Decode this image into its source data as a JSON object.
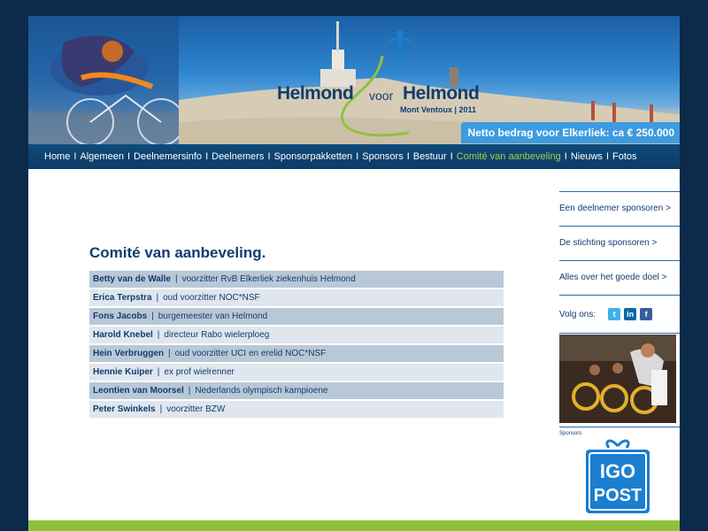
{
  "header": {
    "logo": {
      "word1": "Helmond",
      "word2": "voor",
      "word3": "Helmond",
      "subtitle": "Mont Ventoux | 2011"
    },
    "netto": "Netto bedrag voor Elkerliek: ca € 250.000"
  },
  "nav": {
    "items": [
      {
        "label": "Home",
        "active": false
      },
      {
        "label": "Algemeen",
        "active": false
      },
      {
        "label": "Deelnemersinfo",
        "active": false
      },
      {
        "label": "Deelnemers",
        "active": false
      },
      {
        "label": "Sponsorpakketten",
        "active": false
      },
      {
        "label": "Sponsors",
        "active": false
      },
      {
        "label": "Bestuur",
        "active": false
      },
      {
        "label": "Comité van aanbeveling",
        "active": true
      },
      {
        "label": "Nieuws",
        "active": false
      },
      {
        "label": "Fotos",
        "active": false
      }
    ],
    "separator": "I"
  },
  "main": {
    "title": "Comité van aanbeveling.",
    "members": [
      {
        "name": "Betty van de Walle",
        "role": "voorzitter RvB Elkerliek ziekenhuis Helmond"
      },
      {
        "name": "Erica Terpstra",
        "role": "oud voorzitter NOC*NSF"
      },
      {
        "name": "Fons Jacobs",
        "role": "burgemeester van Helmond"
      },
      {
        "name": "Harold Knebel",
        "role": "directeur Rabo wielerploeg"
      },
      {
        "name": "Hein Verbruggen",
        "role": "oud voorzitter UCI en erelid NOC*NSF"
      },
      {
        "name": "Hennie Kuiper",
        "role": "ex prof wielrenner"
      },
      {
        "name": "Leontien van Moorsel",
        "role": "Nederlands olympisch kampioene"
      },
      {
        "name": "Peter Swinkels",
        "role": "voorzitter BZW"
      }
    ],
    "divider": "|"
  },
  "sidebar": {
    "links": [
      "Een deelnemer sponsoren >",
      "De stichting sponsoren >",
      "Alles over het goede doel >"
    ],
    "follow_label": "Volg ons:",
    "social": [
      "twitter-icon",
      "linkedin-icon",
      "facebook-icon"
    ],
    "social_glyphs": {
      "twitter": "t",
      "linkedin": "in",
      "facebook": "f"
    },
    "sponsors_label": "Sponsors",
    "sponsor_logo": {
      "line1": "IGO",
      "line2": "POST"
    }
  },
  "colors": {
    "background": "#0c2a4a",
    "nav": "#0b3c66",
    "active_nav": "#9fd14f",
    "netto_box": "#3d9be0",
    "title": "#123c6e",
    "footer": "#8fc13e"
  }
}
